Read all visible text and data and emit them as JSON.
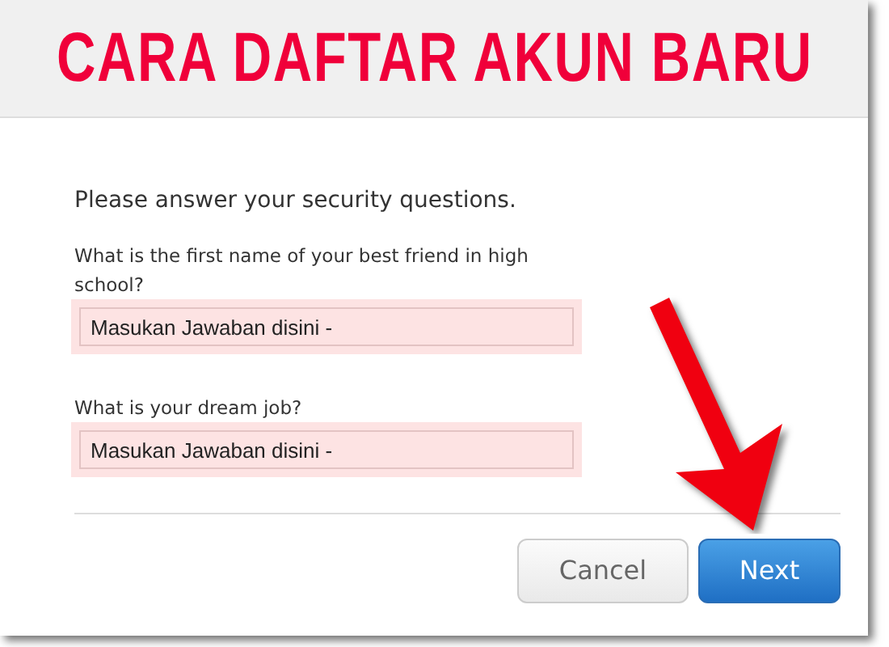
{
  "banner": {
    "title": "CARA DAFTAR AKUN BARU"
  },
  "intro": "Please answer your security questions.",
  "questions": [
    {
      "label": "What is the first name of your best friend in high school?",
      "value": "Masukan Jawaban disini -",
      "invalid": true
    },
    {
      "label": "What is your dream job?",
      "value": "Masukan Jawaban disini -",
      "invalid": true
    }
  ],
  "buttons": [
    {
      "label": "Cancel",
      "kind": "secondary"
    },
    {
      "label": "Next",
      "kind": "primary"
    }
  ]
}
